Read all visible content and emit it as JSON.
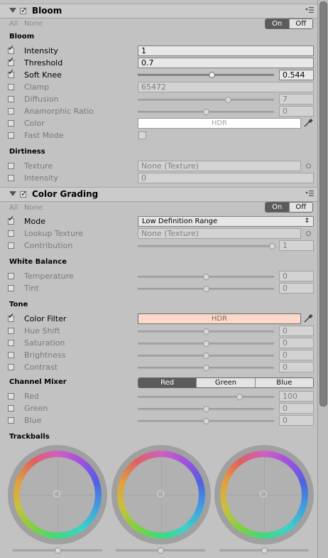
{
  "bloom": {
    "title": "Bloom",
    "all": "All",
    "none": "None",
    "on": "On",
    "off": "Off",
    "section_bloom": "Bloom",
    "intensity_label": "Intensity",
    "intensity_value": "1",
    "threshold_label": "Threshold",
    "threshold_value": "0.7",
    "softknee_label": "Soft Knee",
    "softknee_value": "0.544",
    "clamp_label": "Clamp",
    "clamp_value": "65472",
    "diffusion_label": "Diffusion",
    "diffusion_value": "7",
    "anamorphic_label": "Anamorphic Ratio",
    "anamorphic_value": "0",
    "color_label": "Color",
    "color_value": "HDR",
    "fastmode_label": "Fast Mode",
    "section_dirt": "Dirtiness",
    "texture_label": "Texture",
    "texture_value": "None (Texture)",
    "dirt_intensity_label": "Intensity",
    "dirt_intensity_value": "0"
  },
  "grading": {
    "title": "Color Grading",
    "all": "All",
    "none": "None",
    "on": "On",
    "off": "Off",
    "mode_label": "Mode",
    "mode_value": "Low Definition Range",
    "lookup_label": "Lookup Texture",
    "lookup_value": "None (Texture)",
    "contribution_label": "Contribution",
    "contribution_value": "1",
    "section_wb": "White Balance",
    "temperature_label": "Temperature",
    "temperature_value": "0",
    "tint_label": "Tint",
    "tint_value": "0",
    "section_tone": "Tone",
    "colorfilter_label": "Color Filter",
    "colorfilter_value": "HDR",
    "hueshift_label": "Hue Shift",
    "hueshift_value": "0",
    "saturation_label": "Saturation",
    "saturation_value": "0",
    "brightness_label": "Brightness",
    "brightness_value": "0",
    "contrast_label": "Contrast",
    "contrast_value": "0",
    "section_mixer": "Channel Mixer",
    "mixer_red_tab": "Red",
    "mixer_green_tab": "Green",
    "mixer_blue_tab": "Blue",
    "red_label": "Red",
    "red_value": "100",
    "green_label": "Green",
    "green_value": "0",
    "blue_label": "Blue",
    "blue_value": "0",
    "section_trackballs": "Trackballs"
  },
  "colors": {
    "color_filter_swatch": "#fcd9c8",
    "color_swatch": "#ffffff"
  },
  "icons": [
    "fold-arrow-icon",
    "header-menu-icon",
    "checkbox-icon",
    "eyedropper-icon",
    "object-picker-icon",
    "dropdown-arrow-icon",
    "color-wheel-icon"
  ]
}
